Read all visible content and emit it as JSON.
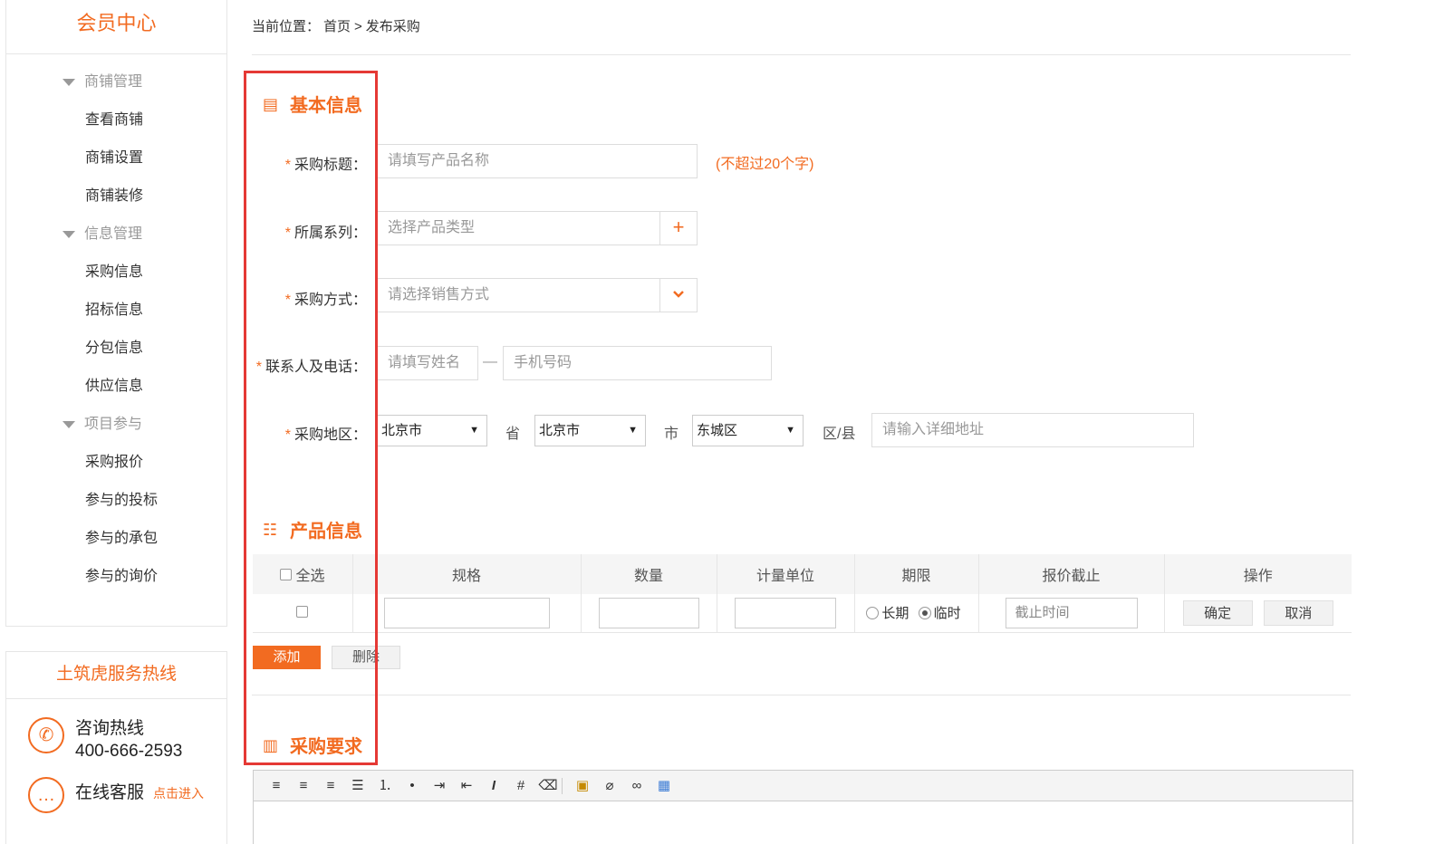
{
  "sidebar": {
    "title": "会员中心",
    "groups": [
      {
        "label": "商铺管理",
        "items": [
          "查看商铺",
          "商铺设置",
          "商铺装修"
        ]
      },
      {
        "label": "信息管理",
        "items": [
          "采购信息",
          "招标信息",
          "分包信息",
          "供应信息"
        ]
      },
      {
        "label": "项目参与",
        "items": [
          "采购报价",
          "参与的投标",
          "参与的承包",
          "参与的询价"
        ]
      }
    ],
    "hotline": {
      "title": "土筑虎服务热线",
      "consult_label": "咨询热线",
      "consult_phone": "400-666-2593",
      "online_label": "在线客服",
      "online_link": "点击进入"
    }
  },
  "breadcrumb": {
    "prefix": "当前位置：",
    "home": "首页",
    "sep": ">",
    "current": "发布采购"
  },
  "basic": {
    "title": "基本信息",
    "title_field": {
      "label": "采购标题：",
      "placeholder": "请填写产品名称",
      "hint": "(不超过20个字)"
    },
    "series_field": {
      "label": "所属系列：",
      "placeholder": "选择产品类型",
      "btn": "+"
    },
    "method_field": {
      "label": "采购方式：",
      "placeholder": "请选择销售方式",
      "btn": "⌄"
    },
    "contact_field": {
      "label": "联系人及电话：",
      "name_placeholder": "请填写姓名",
      "dash": "—",
      "phone_placeholder": "手机号码"
    },
    "region_field": {
      "label": "采购地区：",
      "province": "北京市",
      "province_unit": "省",
      "city": "北京市",
      "city_unit": "市",
      "district": "东城区",
      "district_unit": "区/县",
      "address_placeholder": "请输入详细地址"
    },
    "required_mark": "*"
  },
  "product": {
    "title": "产品信息",
    "columns": [
      "全选",
      "规格",
      "数量",
      "计量单位",
      "期限",
      "报价截止",
      "操作"
    ],
    "row": {
      "term_long": "长期",
      "term_temp": "临时",
      "deadline_placeholder": "截止时间",
      "confirm": "确定",
      "cancel": "取消"
    },
    "add_btn": "添加",
    "delete_btn": "删除"
  },
  "requirement": {
    "title": "采购要求"
  },
  "editor_tools": [
    "align-left",
    "align-center",
    "align-right",
    "align-justify",
    "ordered-list",
    "unordered-list",
    "indent",
    "outdent",
    "italic",
    "table-grid",
    "eraser",
    "image",
    "attachment",
    "link",
    "table"
  ]
}
